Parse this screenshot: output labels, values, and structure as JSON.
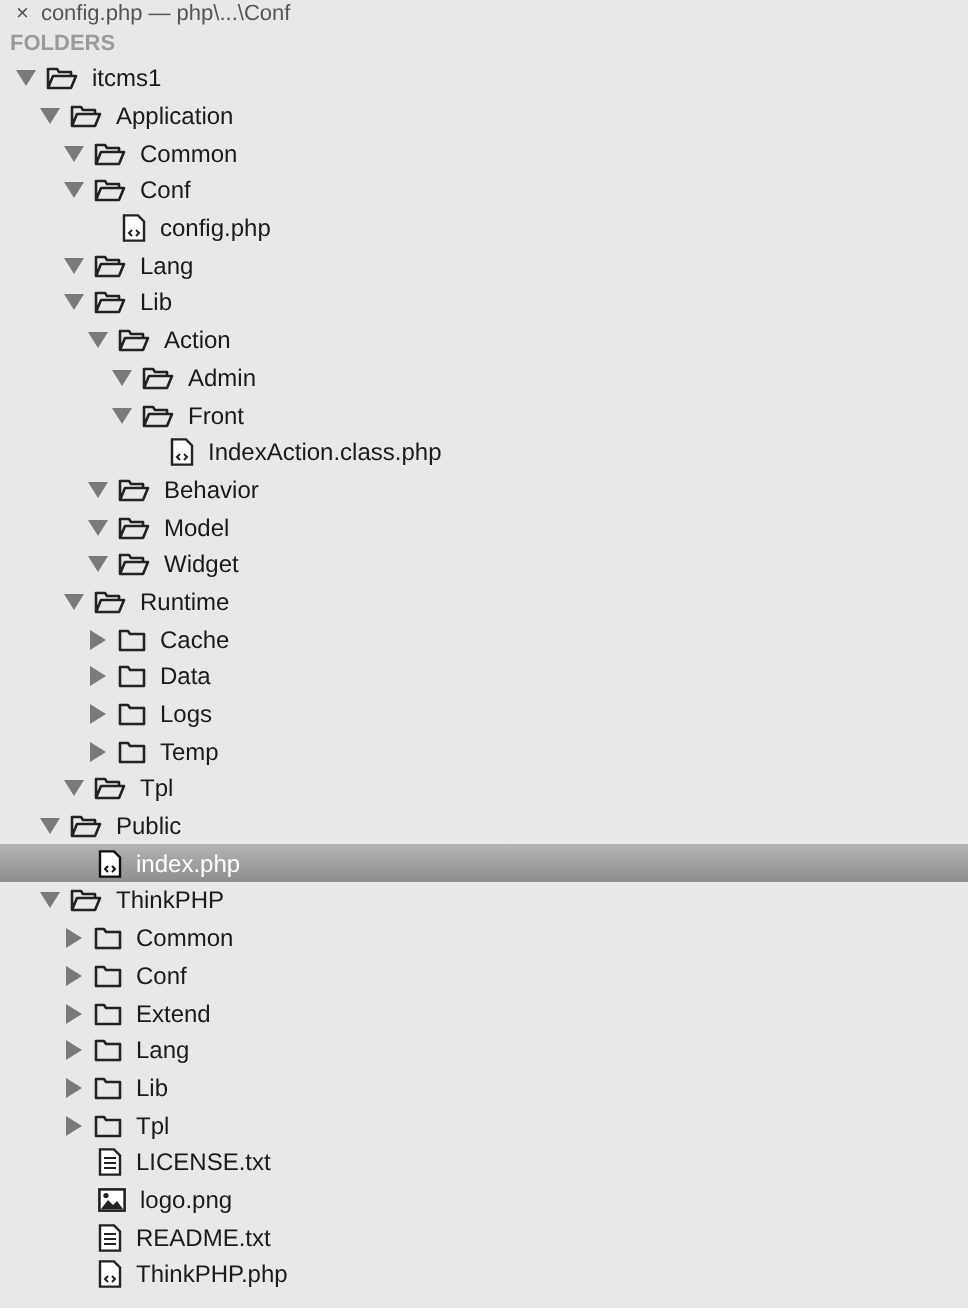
{
  "open_file": {
    "close": "×",
    "label": "config.php — php\\...\\Conf"
  },
  "folders_header": "FOLDERS",
  "tree": [
    {
      "kind": "folder",
      "label": "itcms1",
      "expanded": true,
      "selected": false,
      "children": [
        {
          "kind": "folder",
          "label": "Application",
          "expanded": true,
          "selected": false,
          "children": [
            {
              "kind": "folder",
              "label": "Common",
              "expanded": true,
              "selected": false
            },
            {
              "kind": "folder",
              "label": "Conf",
              "expanded": true,
              "selected": false,
              "children": [
                {
                  "kind": "code",
                  "label": "config.php",
                  "selected": false
                }
              ]
            },
            {
              "kind": "folder",
              "label": "Lang",
              "expanded": true,
              "selected": false
            },
            {
              "kind": "folder",
              "label": "Lib",
              "expanded": true,
              "selected": false,
              "children": [
                {
                  "kind": "folder",
                  "label": "Action",
                  "expanded": true,
                  "selected": false,
                  "children": [
                    {
                      "kind": "folder",
                      "label": "Admin",
                      "expanded": true,
                      "selected": false
                    },
                    {
                      "kind": "folder",
                      "label": "Front",
                      "expanded": true,
                      "selected": false,
                      "children": [
                        {
                          "kind": "code",
                          "label": "IndexAction.class.php",
                          "selected": false
                        }
                      ]
                    }
                  ]
                },
                {
                  "kind": "folder",
                  "label": "Behavior",
                  "expanded": true,
                  "selected": false
                },
                {
                  "kind": "folder",
                  "label": "Model",
                  "expanded": true,
                  "selected": false
                },
                {
                  "kind": "folder",
                  "label": "Widget",
                  "expanded": true,
                  "selected": false
                }
              ]
            },
            {
              "kind": "folder",
              "label": "Runtime",
              "expanded": true,
              "selected": false,
              "children": [
                {
                  "kind": "folder",
                  "label": "Cache",
                  "expanded": false,
                  "selected": false
                },
                {
                  "kind": "folder",
                  "label": "Data",
                  "expanded": false,
                  "selected": false
                },
                {
                  "kind": "folder",
                  "label": "Logs",
                  "expanded": false,
                  "selected": false
                },
                {
                  "kind": "folder",
                  "label": "Temp",
                  "expanded": false,
                  "selected": false
                }
              ]
            },
            {
              "kind": "folder",
              "label": "Tpl",
              "expanded": true,
              "selected": false
            }
          ]
        },
        {
          "kind": "folder",
          "label": "Public",
          "expanded": true,
          "selected": false,
          "children": [
            {
              "kind": "code",
              "label": "index.php",
              "selected": true
            }
          ]
        },
        {
          "kind": "folder",
          "label": "ThinkPHP",
          "expanded": true,
          "selected": false,
          "children": [
            {
              "kind": "folder",
              "label": "Common",
              "expanded": false,
              "selected": false
            },
            {
              "kind": "folder",
              "label": "Conf",
              "expanded": false,
              "selected": false
            },
            {
              "kind": "folder",
              "label": "Extend",
              "expanded": false,
              "selected": false
            },
            {
              "kind": "folder",
              "label": "Lang",
              "expanded": false,
              "selected": false
            },
            {
              "kind": "folder",
              "label": "Lib",
              "expanded": false,
              "selected": false
            },
            {
              "kind": "folder",
              "label": "Tpl",
              "expanded": false,
              "selected": false
            },
            {
              "kind": "text",
              "label": "LICENSE.txt",
              "selected": false
            },
            {
              "kind": "image",
              "label": "logo.png",
              "selected": false
            },
            {
              "kind": "text",
              "label": "README.txt",
              "selected": false
            },
            {
              "kind": "code",
              "label": "ThinkPHP.php",
              "selected": false
            }
          ]
        }
      ]
    }
  ]
}
